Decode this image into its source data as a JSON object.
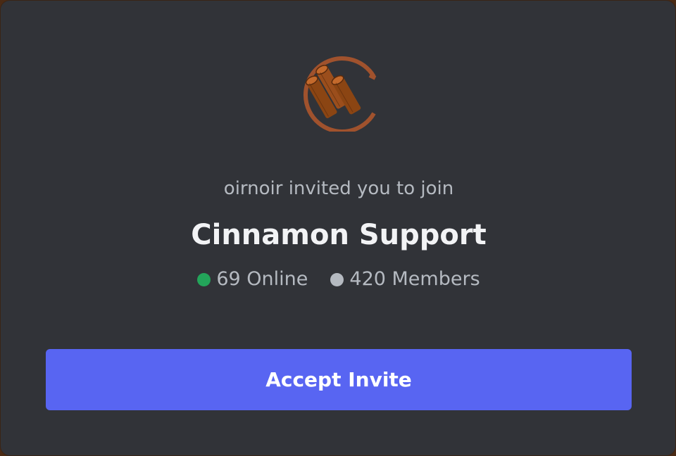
{
  "invite": {
    "inviter_line": "oirnoir invited you to join",
    "server_name": "Cinnamon Support",
    "online_label": "69 Online",
    "members_label": "420 Members",
    "accept_label": "Accept Invite",
    "server_icon": "cinnamon-sticks-icon"
  },
  "colors": {
    "background": "#313338",
    "accent": "#5865f2",
    "online": "#23a55a",
    "icon_brown": "#a0522d"
  }
}
